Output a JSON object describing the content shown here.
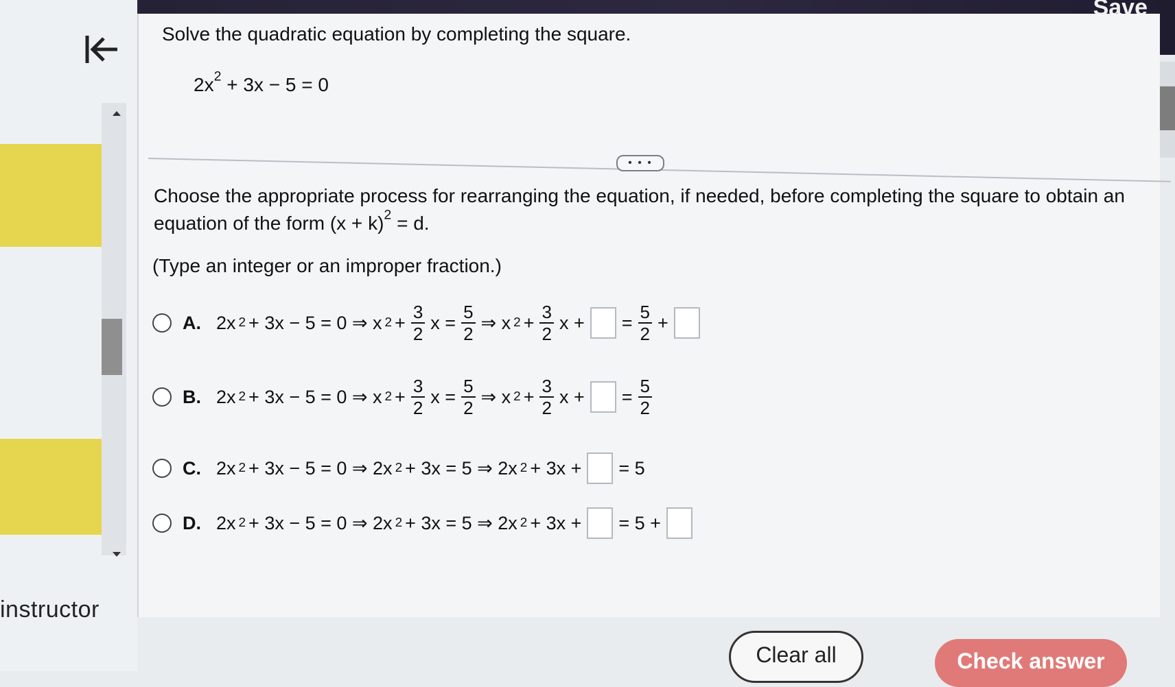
{
  "header": {
    "save_label": "Save"
  },
  "sidebar": {
    "instructor_label": "instructor"
  },
  "question": {
    "prompt": "Solve the quadratic equation by completing the square.",
    "equation": {
      "a": "2x",
      "exp": "2",
      "rest": "+ 3x − 5 = 0"
    },
    "more_label": "• • •",
    "instruction_text": "Choose the appropriate process for rearranging the equation, if needed, before completing the square to obtain an equation of the form",
    "form_base": "(x + k)",
    "form_exp": "2",
    "form_rest": " = d.",
    "hint": "(Type an integer or an improper fraction.)"
  },
  "options": [
    {
      "letter": "A.",
      "lhs": "2x",
      "lhs_exp": "2",
      "step1": "+ 3x − 5 = 0 ⇒ x",
      "step1_exp": "2",
      "plus": "+",
      "frac1_num": "3",
      "frac1_den": "2",
      "eq": "x =",
      "frac2_num": "5",
      "frac2_den": "2",
      "arrow": "⇒ x",
      "arrow_exp": "2",
      "plus2": "+",
      "frac3_num": "3",
      "frac3_den": "2",
      "xplus": "x +",
      "equals": "=",
      "frac4_num": "5",
      "frac4_den": "2",
      "plus3": "+"
    },
    {
      "letter": "B.",
      "lhs": "2x",
      "lhs_exp": "2",
      "step1": "+ 3x − 5 = 0 ⇒ x",
      "step1_exp": "2",
      "plus": "+",
      "frac1_num": "3",
      "frac1_den": "2",
      "eq": "x =",
      "frac2_num": "5",
      "frac2_den": "2",
      "arrow": "⇒ x",
      "arrow_exp": "2",
      "plus2": "+",
      "frac3_num": "3",
      "frac3_den": "2",
      "xplus": "x +",
      "equals": "=",
      "frac4_num": "5",
      "frac4_den": "2"
    },
    {
      "letter": "C.",
      "lhs": "2x",
      "lhs_exp": "2",
      "step1": "+ 3x − 5 = 0 ⇒ 2x",
      "step1_exp": "2",
      "step2": "+ 3x = 5 ⇒ 2x",
      "step2_exp": "2",
      "step3": "+ 3x +",
      "tail": "= 5"
    },
    {
      "letter": "D.",
      "lhs": "2x",
      "lhs_exp": "2",
      "step1": "+ 3x − 5 = 0 ⇒ 2x",
      "step1_exp": "2",
      "step2": "+ 3x = 5 ⇒ 2x",
      "step2_exp": "2",
      "step3": "+ 3x +",
      "tail": "= 5 +"
    }
  ],
  "footer": {
    "clear_label": "Clear all",
    "check_label": "Check answer"
  },
  "colors": {
    "topbar": "#2d2840",
    "accent_yellow": "#e6d54e",
    "check_button": "#e07a78"
  },
  "icons": {
    "back": "back-to-start-icon",
    "scroll_up": "scroll-up-icon",
    "scroll_down": "scroll-down-icon"
  }
}
